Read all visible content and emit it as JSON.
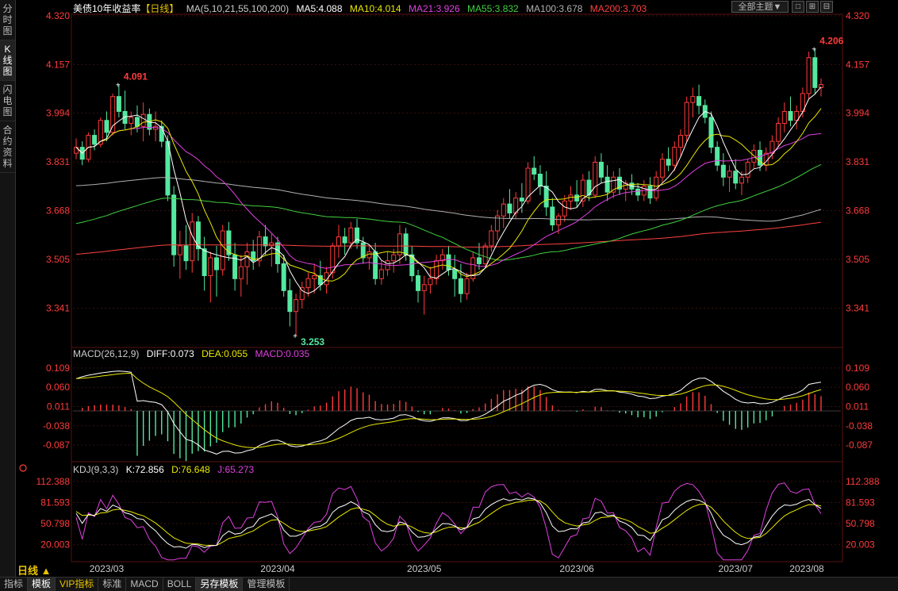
{
  "left_tabs": [
    {
      "label": "分时图"
    },
    {
      "label": "K线图"
    },
    {
      "label": "闪电图"
    },
    {
      "label": "合约资料"
    }
  ],
  "header": {
    "title": "美债10年收益率",
    "period_tag": "【日线】",
    "ma_label": "MA(5,10,21,55,100,200)",
    "ma5": "MA5:4.088",
    "ma10": "MA10:4.014",
    "ma21": "MA21:3.926",
    "ma55": "MA55:3.832",
    "ma100": "MA100:3.678",
    "ma200": "MA200:3.703",
    "theme_button": "全部主题▼",
    "window_buttons": [
      "□",
      "⊞",
      "⊟"
    ]
  },
  "macd_header": {
    "name": "MACD(26,12,9)",
    "diff": "DIFF:0.073",
    "dea": "DEA:0.055",
    "macd": "MACD:0.035"
  },
  "kdj_header": {
    "name": "KDJ(9,3,3)",
    "k": "K:72.856",
    "d": "D:76.648",
    "j": "J:65.273"
  },
  "period_button": "日线 ▲",
  "bottom_tabs": [
    {
      "label": "指标"
    },
    {
      "label": "模板"
    },
    {
      "label": "VIP指标"
    },
    {
      "label": "标准"
    },
    {
      "label": "MACD"
    },
    {
      "label": "BOLL"
    },
    {
      "label": "另存模板"
    },
    {
      "label": "管理模板"
    }
  ],
  "colors": {
    "up": "#ff3b3b",
    "down": "#54e8a0",
    "ma5": "#ffffff",
    "ma10": "#e8e800",
    "ma21": "#e040e0",
    "ma55": "#40d040",
    "ma100": "#b0b0b0",
    "ma200": "#ff4040",
    "label": "#ff3b3b",
    "grid": "#3a1010"
  },
  "chart_data": [
    {
      "type": "candlestick",
      "title": "美债10年收益率【日线】",
      "y_ticks": [
        "4.320",
        "4.157",
        "3.994",
        "3.831",
        "3.668",
        "3.505",
        "3.341"
      ],
      "ylim": [
        3.215,
        4.32
      ],
      "x_ticks": [
        "2023/03",
        "2023/04",
        "2023/05",
        "2023/06",
        "2023/07",
        "2023/08"
      ],
      "annotations": [
        {
          "label": "4.091",
          "type": "high"
        },
        {
          "label": "3.253",
          "type": "low"
        },
        {
          "label": "4.206",
          "type": "high"
        }
      ],
      "series_names": [
        "MA5",
        "MA10",
        "MA21",
        "MA55",
        "MA100",
        "MA200"
      ],
      "candles": [
        [
          3.86,
          3.91,
          3.84,
          3.88
        ],
        [
          3.88,
          3.9,
          3.82,
          3.84
        ],
        [
          3.84,
          3.93,
          3.83,
          3.92
        ],
        [
          3.92,
          3.94,
          3.87,
          3.89
        ],
        [
          3.89,
          3.98,
          3.88,
          3.97
        ],
        [
          3.97,
          4.0,
          3.9,
          3.93
        ],
        [
          3.93,
          4.06,
          3.92,
          4.05
        ],
        [
          4.05,
          4.09,
          3.98,
          4.0
        ],
        [
          4.0,
          4.07,
          3.94,
          3.96
        ],
        [
          3.96,
          4.0,
          3.92,
          3.98
        ],
        [
          3.98,
          4.02,
          3.93,
          3.95
        ],
        [
          3.95,
          4.03,
          3.9,
          3.99
        ],
        [
          3.99,
          4.01,
          3.92,
          3.94
        ],
        [
          3.94,
          4.0,
          3.9,
          3.95
        ],
        [
          3.95,
          3.97,
          3.88,
          3.9
        ],
        [
          3.9,
          3.92,
          3.7,
          3.72
        ],
        [
          3.72,
          3.75,
          3.48,
          3.52
        ],
        [
          3.52,
          3.6,
          3.44,
          3.55
        ],
        [
          3.55,
          3.62,
          3.47,
          3.5
        ],
        [
          3.5,
          3.66,
          3.46,
          3.63
        ],
        [
          3.63,
          3.65,
          3.5,
          3.54
        ],
        [
          3.54,
          3.58,
          3.4,
          3.45
        ],
        [
          3.45,
          3.53,
          3.36,
          3.51
        ],
        [
          3.51,
          3.55,
          3.38,
          3.47
        ],
        [
          3.47,
          3.62,
          3.45,
          3.6
        ],
        [
          3.6,
          3.63,
          3.5,
          3.52
        ],
        [
          3.52,
          3.56,
          3.4,
          3.44
        ],
        [
          3.44,
          3.52,
          3.38,
          3.48
        ],
        [
          3.48,
          3.56,
          3.42,
          3.53
        ],
        [
          3.53,
          3.57,
          3.47,
          3.5
        ],
        [
          3.5,
          3.6,
          3.48,
          3.58
        ],
        [
          3.58,
          3.62,
          3.52,
          3.55
        ],
        [
          3.55,
          3.59,
          3.48,
          3.56
        ],
        [
          3.56,
          3.58,
          3.46,
          3.49
        ],
        [
          3.49,
          3.52,
          3.38,
          3.4
        ],
        [
          3.4,
          3.44,
          3.28,
          3.33
        ],
        [
          3.33,
          3.39,
          3.25,
          3.37
        ],
        [
          3.37,
          3.43,
          3.34,
          3.41
        ],
        [
          3.41,
          3.46,
          3.38,
          3.44
        ],
        [
          3.44,
          3.49,
          3.39,
          3.45
        ],
        [
          3.45,
          3.5,
          3.4,
          3.42
        ],
        [
          3.42,
          3.48,
          3.39,
          3.46
        ],
        [
          3.46,
          3.56,
          3.44,
          3.55
        ],
        [
          3.55,
          3.62,
          3.51,
          3.58
        ],
        [
          3.58,
          3.61,
          3.52,
          3.56
        ],
        [
          3.56,
          3.63,
          3.54,
          3.61
        ],
        [
          3.61,
          3.64,
          3.54,
          3.56
        ],
        [
          3.56,
          3.58,
          3.49,
          3.51
        ],
        [
          3.51,
          3.55,
          3.47,
          3.53
        ],
        [
          3.53,
          3.56,
          3.42,
          3.44
        ],
        [
          3.44,
          3.5,
          3.42,
          3.47
        ],
        [
          3.47,
          3.53,
          3.45,
          3.5
        ],
        [
          3.5,
          3.54,
          3.46,
          3.52
        ],
        [
          3.52,
          3.62,
          3.49,
          3.59
        ],
        [
          3.59,
          3.61,
          3.5,
          3.52
        ],
        [
          3.52,
          3.55,
          3.43,
          3.45
        ],
        [
          3.45,
          3.47,
          3.36,
          3.4
        ],
        [
          3.4,
          3.45,
          3.32,
          3.42
        ],
        [
          3.42,
          3.48,
          3.39,
          3.44
        ],
        [
          3.44,
          3.52,
          3.42,
          3.5
        ],
        [
          3.5,
          3.54,
          3.47,
          3.52
        ],
        [
          3.52,
          3.55,
          3.45,
          3.47
        ],
        [
          3.47,
          3.52,
          3.38,
          3.44
        ],
        [
          3.44,
          3.49,
          3.36,
          3.39
        ],
        [
          3.39,
          3.46,
          3.37,
          3.44
        ],
        [
          3.44,
          3.53,
          3.43,
          3.51
        ],
        [
          3.51,
          3.56,
          3.47,
          3.49
        ],
        [
          3.49,
          3.56,
          3.48,
          3.55
        ],
        [
          3.55,
          3.62,
          3.53,
          3.6
        ],
        [
          3.6,
          3.67,
          3.57,
          3.65
        ],
        [
          3.65,
          3.71,
          3.61,
          3.69
        ],
        [
          3.69,
          3.74,
          3.64,
          3.66
        ],
        [
          3.66,
          3.73,
          3.64,
          3.71
        ],
        [
          3.71,
          3.76,
          3.66,
          3.7
        ],
        [
          3.7,
          3.83,
          3.69,
          3.81
        ],
        [
          3.81,
          3.85,
          3.77,
          3.79
        ],
        [
          3.79,
          3.82,
          3.72,
          3.75
        ],
        [
          3.75,
          3.8,
          3.65,
          3.68
        ],
        [
          3.68,
          3.71,
          3.6,
          3.62
        ],
        [
          3.62,
          3.66,
          3.59,
          3.65
        ],
        [
          3.65,
          3.72,
          3.63,
          3.7
        ],
        [
          3.7,
          3.75,
          3.67,
          3.72
        ],
        [
          3.72,
          3.77,
          3.68,
          3.7
        ],
        [
          3.7,
          3.79,
          3.68,
          3.77
        ],
        [
          3.77,
          3.8,
          3.7,
          3.72
        ],
        [
          3.72,
          3.85,
          3.71,
          3.83
        ],
        [
          3.83,
          3.86,
          3.76,
          3.78
        ],
        [
          3.78,
          3.82,
          3.7,
          3.73
        ],
        [
          3.73,
          3.8,
          3.71,
          3.78
        ],
        [
          3.78,
          3.81,
          3.72,
          3.74
        ],
        [
          3.74,
          3.77,
          3.7,
          3.76
        ],
        [
          3.76,
          3.79,
          3.72,
          3.74
        ],
        [
          3.74,
          3.76,
          3.7,
          3.72
        ],
        [
          3.72,
          3.77,
          3.7,
          3.75
        ],
        [
          3.75,
          3.78,
          3.69,
          3.71
        ],
        [
          3.71,
          3.8,
          3.7,
          3.78
        ],
        [
          3.78,
          3.86,
          3.76,
          3.84
        ],
        [
          3.84,
          3.88,
          3.8,
          3.82
        ],
        [
          3.82,
          3.9,
          3.8,
          3.88
        ],
        [
          3.88,
          3.94,
          3.85,
          3.92
        ],
        [
          3.92,
          4.05,
          3.9,
          4.03
        ],
        [
          4.03,
          4.08,
          3.98,
          4.05
        ],
        [
          4.05,
          4.09,
          3.99,
          4.02
        ],
        [
          4.02,
          4.04,
          3.96,
          3.98
        ],
        [
          3.98,
          4.0,
          3.86,
          3.88
        ],
        [
          3.88,
          3.9,
          3.8,
          3.82
        ],
        [
          3.82,
          3.86,
          3.75,
          3.78
        ],
        [
          3.78,
          3.82,
          3.73,
          3.8
        ],
        [
          3.8,
          3.84,
          3.74,
          3.76
        ],
        [
          3.76,
          3.8,
          3.72,
          3.78
        ],
        [
          3.78,
          3.84,
          3.76,
          3.83
        ],
        [
          3.83,
          3.89,
          3.81,
          3.87
        ],
        [
          3.87,
          3.9,
          3.8,
          3.82
        ],
        [
          3.82,
          3.88,
          3.8,
          3.86
        ],
        [
          3.86,
          3.92,
          3.84,
          3.9
        ],
        [
          3.9,
          3.98,
          3.88,
          3.96
        ],
        [
          3.96,
          4.03,
          3.93,
          4.0
        ],
        [
          4.0,
          4.05,
          3.95,
          3.97
        ],
        [
          3.97,
          4.02,
          3.94,
          4.0
        ],
        [
          4.0,
          4.08,
          3.98,
          4.06
        ],
        [
          4.06,
          4.2,
          4.04,
          4.18
        ],
        [
          4.18,
          4.21,
          4.06,
          4.08
        ],
        [
          4.08,
          4.11,
          4.05,
          4.09
        ]
      ]
    },
    {
      "type": "bar",
      "title": "MACD(26,12,9)",
      "y_ticks": [
        "0.109",
        "0.060",
        "0.011",
        "-0.038",
        "-0.087"
      ],
      "ylim": [
        -0.125,
        0.125
      ],
      "series_names": [
        "DIFF",
        "DEA",
        "MACD"
      ],
      "diff_end": 0.073,
      "dea_end": 0.055,
      "macd_end": 0.035
    },
    {
      "type": "line",
      "title": "KDJ(9,3,3)",
      "y_ticks": [
        "112.388",
        "81.593",
        "50.798",
        "20.003"
      ],
      "ylim": [
        0,
        125
      ],
      "series_names": [
        "K",
        "D",
        "J"
      ],
      "k_end": 72.856,
      "d_end": 76.648,
      "j_end": 65.273
    }
  ]
}
